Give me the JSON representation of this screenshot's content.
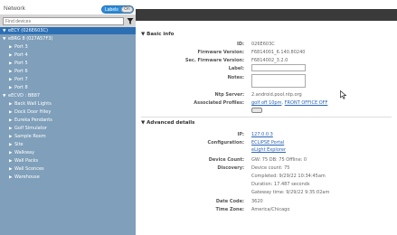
{
  "topbar": {
    "title": "Network",
    "toggle_on": "Labels",
    "toggle_off": "On"
  },
  "sidebar": {
    "filter_placeholder": "Find devices",
    "selected": "eECY (026E603C)",
    "tree": [
      {
        "label": "eBRG 8 (027A57F3)",
        "level": 1,
        "expanded": true
      },
      {
        "label": "Port 3",
        "level": 2
      },
      {
        "label": "Port 4",
        "level": 2
      },
      {
        "label": "Port 5",
        "level": 2
      },
      {
        "label": "Port 6",
        "level": 2
      },
      {
        "label": "Port 7",
        "level": 2
      },
      {
        "label": "Port 8",
        "level": 2
      },
      {
        "label": "eECVD : BB87",
        "level": 1,
        "expanded": true
      },
      {
        "label": "Back Wall Lights",
        "level": 2
      },
      {
        "label": "Dock Door Hiley",
        "level": 2
      },
      {
        "label": "Eureka Pendants",
        "level": 2
      },
      {
        "label": "Golf Simulator",
        "level": 2
      },
      {
        "label": "Sample Room",
        "level": 2
      },
      {
        "label": "Site",
        "level": 2
      },
      {
        "label": "Walkway",
        "level": 2
      },
      {
        "label": "Wall Packs",
        "level": 2
      },
      {
        "label": "Wall Sconces",
        "level": 2
      },
      {
        "label": "Warehouse",
        "level": 2
      }
    ]
  },
  "basic": {
    "heading": "Basic info",
    "id_label": "ID:",
    "id_value": "026E603C",
    "fw_label": "Firmware Version:",
    "fw_value": "F6814001_6.140.80240",
    "secfw_label": "Sec. Firmware Version:",
    "secfw_value": "F6814002_3.2.0",
    "label_label": "Label:",
    "notes_label": "Notes:",
    "ntp_label": "Ntp Server:",
    "ntp_value": "2.android.pool.ntp.org",
    "profiles_label": "Associated Profiles:",
    "profile_1": "golf off 10pm",
    "profile_2": "FRONT OFFICE OFF"
  },
  "advanced": {
    "heading": "Advanced details",
    "ip_label": "IP:",
    "ip_value": "127.0.0.3",
    "config_label": "Configuration:",
    "config_1": "ECLIPSE Portal",
    "config_2": "eLight Explorer",
    "count_label": "Device Count:",
    "count_value": "GW: 75  DB: 75  Offline: 0",
    "discovery_label": "Discovery:",
    "discovery_1": "Device count: 75",
    "discovery_2": "Completed: 9/29/22 10:34:45am",
    "discovery_3": "Duration: 17.487 seconds",
    "discovery_4": "Gateway time: 9/29/22 9:35:02am",
    "date_label": "Date Code:",
    "date_value": "3620",
    "tz_label": "Time Zone:",
    "tz_value": "America/Chicago"
  },
  "colors": {
    "sidebar_bg": "#7f9fba",
    "selected_bg": "#2d6fb3",
    "toggle": "#2f8bd6",
    "link": "#2a64b8"
  }
}
